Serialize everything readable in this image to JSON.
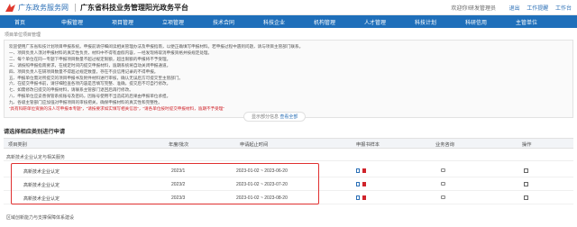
{
  "header": {
    "portal_name": "广东政务服务网",
    "system_title": "广东省科技业务管理阳光政务平台",
    "welcome": "欢迎你!研发管理员",
    "links": [
      "退出",
      "工作提醒",
      "工作台"
    ]
  },
  "nav": {
    "items": [
      "首页",
      "申报管理",
      "项目管理",
      "立项管理",
      "技术合同",
      "科技企业",
      "机构管理",
      "人才管理",
      "科技计划",
      "科研信用",
      "主管单位"
    ]
  },
  "breadcrumb": "项目单位项目管理",
  "notice": {
    "lines": [
      "欢迎使用广东省科技计划项目申报系统。申报前请仔细阅读相关管理办法及申报指南，以便正确填写申报材料。若申报过程中遇到问题，请与项目主管部门联系。",
      "一、项目负责人须对申报材料的真实性负责，材料中不得有虚假内容，一经发现将取消申报资格并按规定处理。",
      "二、每个单位在同一专题下申报项目数量不超过规定限额，超出限额的申报将不予受理。",
      "三、请按照申报指南要求，在规定时间内提交申报材料，逾期系统将自动关闭申报通道。",
      "四、项目负责人在研项目数量不得超过规定数量，存在不良信用记录的不得申报。",
      "五、申报单位需对所提交的项目申报书及附件材料进行审核，确认无误后方可提交至主管部门。",
      "六、在提交申报书前，请仔细检查各项内容是否填写完整、准确，提交后不可自行修改。",
      "七、如需修改已提交的申报材料，请联系主管部门退回后再行修改。",
      "八、申报单位应妥善保管系统账号及密码，因账号使用不当造成的后果由申报单位承担。",
      "九、各级主管部门应加强对申报项目的审核把关，确保申报材料的真实性和完整性。"
    ],
    "highlight": "“具有科研单位资质的法人可申报本专题”，“请按要求如实填写相关信息”，“请各单位按时提交申报材料，逾期不予受理”",
    "expand": {
      "prefix": "显示部分信息",
      "link": "查看全部"
    }
  },
  "section_title": "请选择相应类别进行申请",
  "table": {
    "headers": [
      "项目类别",
      "年度/批次",
      "申请起止时间",
      "申报书样本",
      "业务咨询",
      "操作"
    ],
    "group1": "高新技术企业认定与相关服务",
    "rows": [
      {
        "name": "高新技术企业认定",
        "batch": "2023/1",
        "period": "2023-01-02 ~ 2023-06-20"
      },
      {
        "name": "高新技术企业认定",
        "batch": "2023/2",
        "period": "2023-01-02 ~ 2023-07-20"
      },
      {
        "name": "高新技术企业认定",
        "batch": "2023/3",
        "period": "2023-01-02 ~ 2023-08-20"
      }
    ],
    "group2": "区域创新能力与支撑保障体系建设"
  },
  "colors": {
    "nav_bg": "#1f6fba",
    "highlight": "#e03030",
    "link": "#2b6fb6"
  }
}
